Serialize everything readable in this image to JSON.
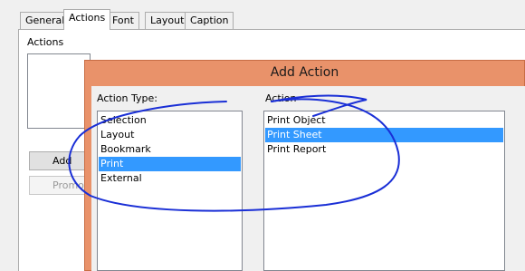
{
  "tabs": [
    {
      "label": "General"
    },
    {
      "label": "Actions"
    },
    {
      "label": "Font"
    },
    {
      "label": "Layout"
    },
    {
      "label": "Caption"
    }
  ],
  "actions_panel": {
    "label": "Actions",
    "add_button": "Add",
    "promote_button": "Promote"
  },
  "dialog": {
    "title": "Add Action",
    "action_type_label": "Action Type:",
    "action_label": "Action",
    "action_types": [
      "Selection",
      "Layout",
      "Bookmark",
      "Print",
      "External"
    ],
    "selected_action_type": "Print",
    "actions": [
      "Print Object",
      "Print Sheet",
      "Print Report"
    ],
    "selected_action": "Print Sheet"
  },
  "colors": {
    "dialog_frame": "#e9926a",
    "selection": "#3399ff",
    "annotation_ink": "#1a2fd6"
  }
}
